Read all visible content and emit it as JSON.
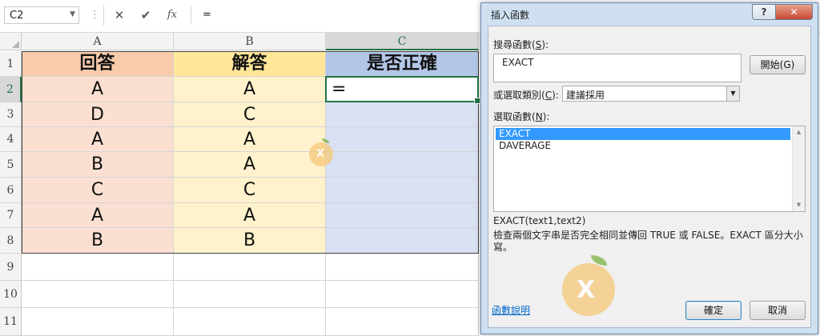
{
  "formula_bar": {
    "name_box": "C2",
    "cancel_icon": "✕",
    "enter_icon": "✔",
    "fx_icon": "fx",
    "formula": "="
  },
  "sheet": {
    "columns": [
      "A",
      "B",
      "C"
    ],
    "rows": [
      "1",
      "2",
      "3",
      "4",
      "5",
      "6",
      "7",
      "8",
      "9",
      "10",
      "11"
    ],
    "headers": {
      "a": "回答",
      "b": "解答",
      "c": "是否正確"
    },
    "data": [
      {
        "a": "A",
        "b": "A",
        "c": "="
      },
      {
        "a": "D",
        "b": "C",
        "c": ""
      },
      {
        "a": "A",
        "b": "A",
        "c": ""
      },
      {
        "a": "B",
        "b": "A",
        "c": ""
      },
      {
        "a": "C",
        "b": "C",
        "c": ""
      },
      {
        "a": "A",
        "b": "A",
        "c": ""
      },
      {
        "a": "B",
        "b": "B",
        "c": ""
      }
    ],
    "active_cell": "C2"
  },
  "dialog": {
    "title": "插入函數",
    "help_btn": "?",
    "close_btn": "✕",
    "search_label": "搜尋函數(",
    "search_key": "S",
    "search_label_end": "):",
    "search_value": "EXACT",
    "go_button": "開始(G)",
    "category_label": "或選取類別(",
    "category_key": "C",
    "category_label_end": "):",
    "category_value": "建議採用",
    "select_label": "選取函數(",
    "select_key": "N",
    "select_label_end": "):",
    "functions": [
      "EXACT",
      "DAVERAGE"
    ],
    "selected_function": "EXACT",
    "signature": "EXACT(text1,text2)",
    "description": "檢查兩個文字串是否完全相同並傳回 TRUE 或 FALSE。EXACT 區分大小寫。",
    "help_link": "函數說明",
    "ok_button": "確定",
    "cancel_button": "取消"
  },
  "colors": {
    "col_a_header": "#f8cbad",
    "col_a": "#fbe0d2",
    "col_b_header": "#ffe699",
    "col_b": "#fff2cc",
    "col_c_header": "#b4c6e7",
    "col_c": "#d9e1f2",
    "excel_green": "#217346",
    "selection_blue": "#3399ff"
  }
}
